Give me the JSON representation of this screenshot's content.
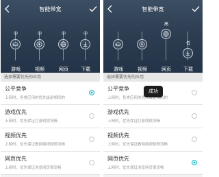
{
  "left_screen": {
    "title": "智能带宽",
    "sliders": [
      {
        "name": "游戏",
        "level": "中",
        "icon": "gamepad-icon"
      },
      {
        "name": "视频",
        "level": "中",
        "icon": "play-icon"
      },
      {
        "name": "网页",
        "level": "中",
        "icon": "globe-icon"
      },
      {
        "name": "下载",
        "level": "中",
        "icon": "download-icon"
      }
    ],
    "section_title": "选择需要优先的应用",
    "options": [
      {
        "title": "公平竞争",
        "desc": "上网时，各类应用的优先级是相同的",
        "selected": true
      },
      {
        "title": "游戏优先",
        "desc": "上网时，优先保证打游戏很流畅",
        "selected": false
      },
      {
        "title": "视频优先",
        "desc": "上网时，优先保证看网络视频很流畅",
        "selected": false
      },
      {
        "title": "网页优先",
        "desc": "上网时，优先保证浏览网页很流畅",
        "selected": false
      }
    ]
  },
  "right_screen": {
    "title": "智能带宽",
    "sliders": [
      {
        "name": "游戏",
        "level": "",
        "icon": "gamepad-icon"
      },
      {
        "name": "视频",
        "level": "",
        "icon": "play-icon"
      },
      {
        "name": "网页",
        "level": "高",
        "icon": "globe-icon"
      },
      {
        "name": "下载",
        "level": "低",
        "icon": "download-icon"
      }
    ],
    "section_title": "选择需要优先的应用",
    "options": [
      {
        "title": "公平竞争",
        "desc": "上网时，各类应用的优先级是相同的",
        "selected": false
      },
      {
        "title": "游戏优先",
        "desc": "上网时，优先保证打游戏很流畅",
        "selected": false
      },
      {
        "title": "视频优先",
        "desc": "上网时，优先保证看网络视频很流畅",
        "selected": false
      },
      {
        "title": "网页优先",
        "desc": "上网时，优先保证浏览网页很流畅",
        "selected": true
      }
    ],
    "toast": "成功"
  },
  "colors": {
    "header_bg": "#2d3e52",
    "accent": "#20b8c8"
  }
}
